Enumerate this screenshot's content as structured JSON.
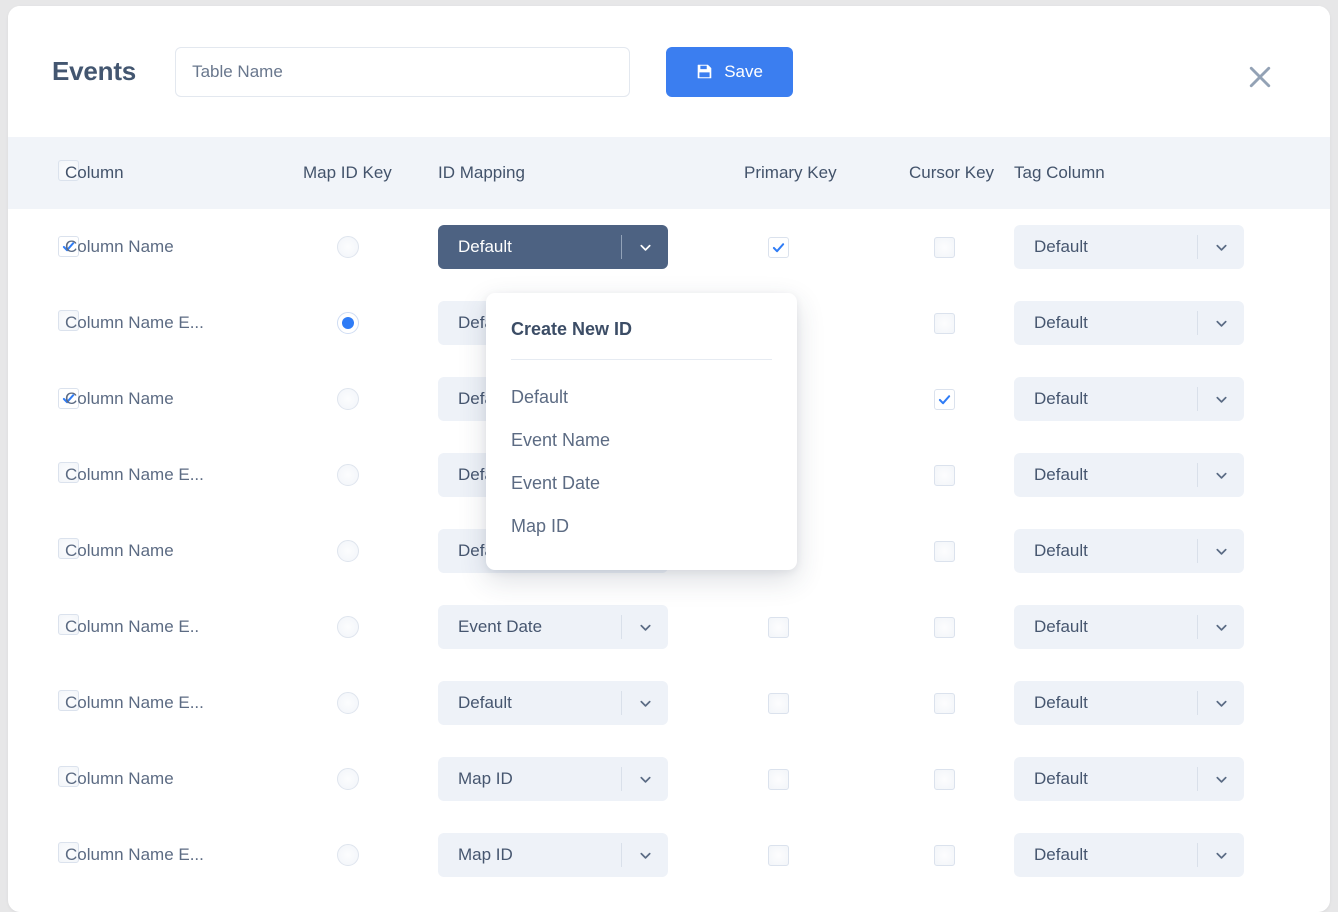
{
  "header": {
    "title": "Events",
    "table_name_value": "",
    "table_name_placeholder": "Table Name",
    "save_label": "Save",
    "save_icon": "floppy-disk-icon",
    "close_icon": "close-icon",
    "accent_color": "#3b7ef0"
  },
  "table": {
    "columns": [
      "Column",
      "Map ID Key",
      "ID Mapping",
      "Primary Key",
      "Cursor Key",
      "Tag Column"
    ],
    "select_all_checked": false,
    "rows": [
      {
        "name": "Column Name",
        "selected": true,
        "map_id_key": false,
        "id_mapping": "Default",
        "id_mapping_active": true,
        "primary_key": true,
        "cursor_key": false,
        "tag_column": "Default"
      },
      {
        "name": "Column Name E...",
        "selected": false,
        "map_id_key": true,
        "id_mapping": "Default",
        "id_mapping_active": false,
        "primary_key": false,
        "cursor_key": false,
        "tag_column": "Default"
      },
      {
        "name": "Column Name",
        "selected": true,
        "map_id_key": false,
        "id_mapping": "Default",
        "id_mapping_active": false,
        "primary_key": false,
        "cursor_key": true,
        "tag_column": "Default"
      },
      {
        "name": "Column Name E...",
        "selected": false,
        "map_id_key": false,
        "id_mapping": "Default",
        "id_mapping_active": false,
        "primary_key": false,
        "cursor_key": false,
        "tag_column": "Default"
      },
      {
        "name": "Column Name",
        "selected": false,
        "map_id_key": false,
        "id_mapping": "Default",
        "id_mapping_active": false,
        "primary_key": false,
        "cursor_key": false,
        "tag_column": "Default"
      },
      {
        "name": "Column Name E..",
        "selected": false,
        "map_id_key": false,
        "id_mapping": "Event Date",
        "id_mapping_active": false,
        "primary_key": false,
        "cursor_key": false,
        "tag_column": "Default"
      },
      {
        "name": "Column Name E...",
        "selected": false,
        "map_id_key": false,
        "id_mapping": "Default",
        "id_mapping_active": false,
        "primary_key": false,
        "cursor_key": false,
        "tag_column": "Default"
      },
      {
        "name": "Column Name",
        "selected": false,
        "map_id_key": false,
        "id_mapping": "Map ID",
        "id_mapping_active": false,
        "primary_key": false,
        "cursor_key": false,
        "tag_column": "Default"
      },
      {
        "name": "Column Name E...",
        "selected": false,
        "map_id_key": false,
        "id_mapping": "Map ID",
        "id_mapping_active": false,
        "primary_key": false,
        "cursor_key": false,
        "tag_column": "Default"
      }
    ]
  },
  "dropdown": {
    "open": true,
    "create_label": "Create New ID",
    "options": [
      "Default",
      "Event Name",
      "Event Date",
      "Map ID"
    ]
  }
}
